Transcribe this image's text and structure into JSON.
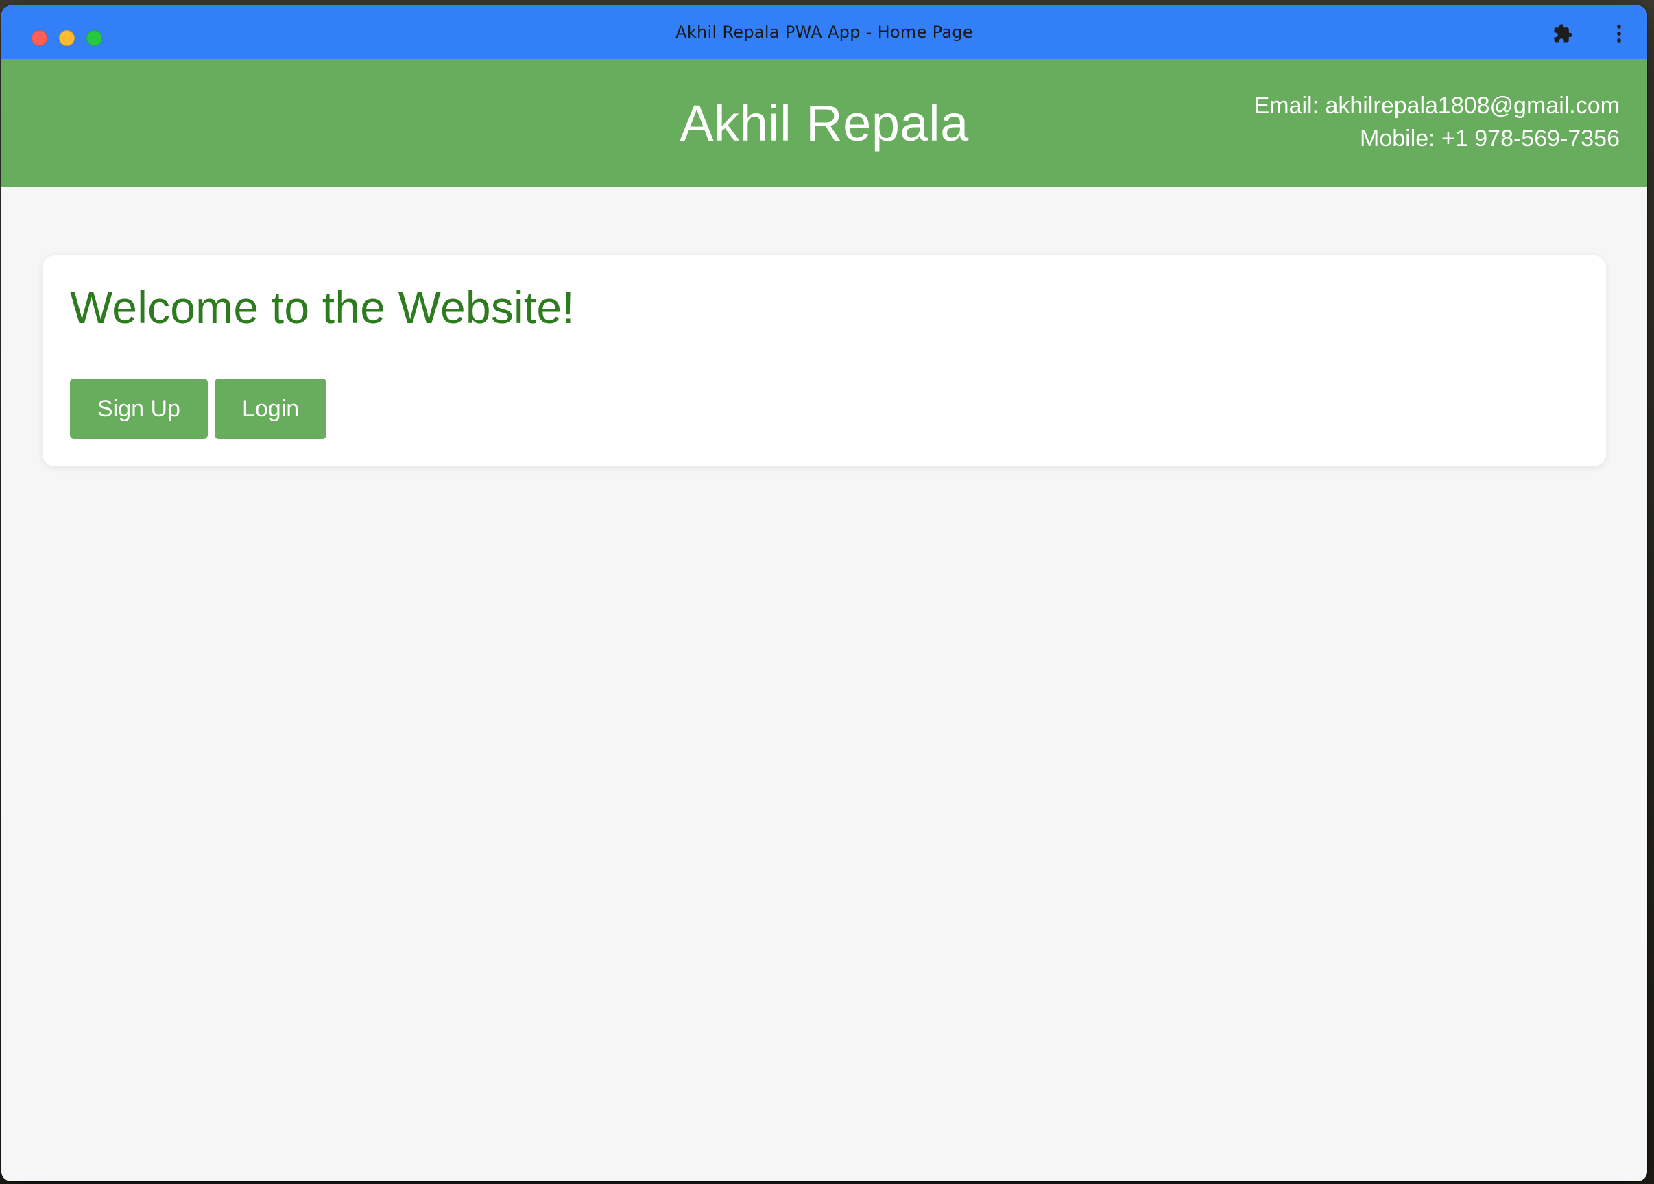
{
  "window": {
    "title": "Akhil Repala PWA App - Home Page"
  },
  "titlebar": {
    "icons": [
      "puzzle-extension-icon",
      "kebab-menu-icon"
    ],
    "color": "#337ff8"
  },
  "header": {
    "title": "Akhil Repala",
    "email": "Email: akhilrepala1808@gmail.com",
    "mobile": "Mobile: +1 978-569-7356",
    "color": "#68ac5d"
  },
  "main": {
    "heading": "Welcome to the Website!",
    "heading_color": "#2e7a1f",
    "buttons": {
      "signup": "Sign Up",
      "login": "Login"
    }
  }
}
